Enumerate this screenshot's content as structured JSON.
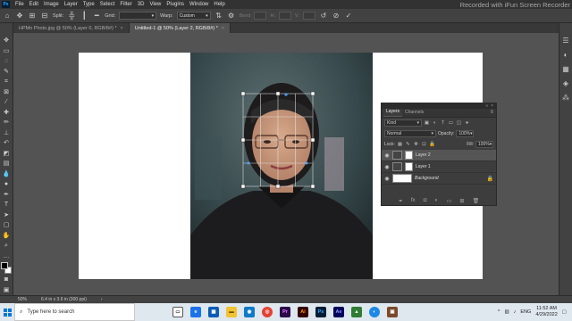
{
  "menubar": {
    "items": [
      "File",
      "Edit",
      "Image",
      "Layer",
      "Type",
      "Select",
      "Filter",
      "3D",
      "View",
      "Plugins",
      "Window",
      "Help"
    ],
    "recorder_watermark": "Recorded with iFun Screen Recorder"
  },
  "options": {
    "split_label": "Split:",
    "grid_label": "Grid:",
    "warp_label": "Warp:",
    "warp_value": "Custom",
    "bend_label": "Bend",
    "h_label": "H:",
    "v_label": "V:"
  },
  "tabs": [
    {
      "label": "HPMn Photo.jpg @ 50% (Layer 0, RGB/8#) *",
      "active": false
    },
    {
      "label": "Untitled-1 @ 50% (Layer 2, RGB/8#) *",
      "active": true
    }
  ],
  "layers_panel": {
    "tabs": [
      "Layers",
      "Channels"
    ],
    "search_placeholder": "Kind",
    "blend_mode": "Normal",
    "opacity_label": "Opacity:",
    "opacity_value": "100%",
    "lock_label": "Lock:",
    "fill_label": "Fill:",
    "fill_value": "100%",
    "layers": [
      {
        "name": "Layer 2",
        "selected": true
      },
      {
        "name": "Layer 1",
        "selected": false
      },
      {
        "name": "Background",
        "selected": false,
        "locked": true
      }
    ]
  },
  "status": {
    "zoom": "50%",
    "doc_size": "6.4 in x 3.6 in (300 ppi)"
  },
  "taskbar": {
    "search_placeholder": "Type here to search",
    "lang": "ENG",
    "time": "11:52 AM",
    "date": "4/29/2022"
  },
  "colors": {
    "ps_accent": "#31a8ff",
    "panel_bg": "#3d3d3d",
    "workspace_bg": "#535353"
  }
}
